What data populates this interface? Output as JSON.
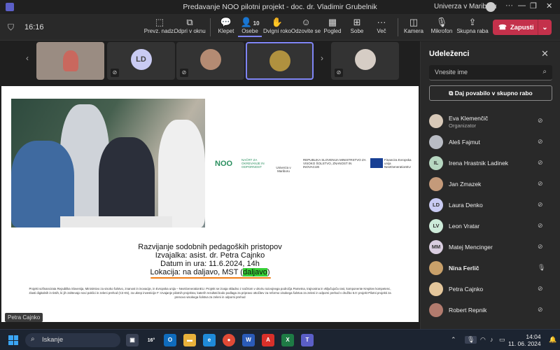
{
  "window": {
    "title": "Predavanje NOO pilotni projekt - doc. dr. Vladimir Grubelnik",
    "org": "Univerza v Mariboru"
  },
  "toolbar": {
    "time": "16:16",
    "items": [
      {
        "label": "Prevz. nadz.",
        "icon": "take-control-icon"
      },
      {
        "label": "Odpri v oknu",
        "icon": "pop-out-icon"
      },
      {
        "label": "Klepet",
        "icon": "chat-icon"
      },
      {
        "label": "Osebe",
        "icon": "people-icon",
        "badge": "10"
      },
      {
        "label": "Dvigni roko",
        "icon": "raise-hand-icon"
      },
      {
        "label": "Odzovite se",
        "icon": "react-icon"
      },
      {
        "label": "Pogled",
        "icon": "view-icon"
      },
      {
        "label": "Sobe",
        "icon": "rooms-icon"
      },
      {
        "label": "Več",
        "icon": "more-icon"
      },
      {
        "label": "Kamera",
        "icon": "camera-off-icon"
      },
      {
        "label": "Mikrofon",
        "icon": "mic-off-icon"
      },
      {
        "label": "Skupna raba",
        "icon": "share-icon"
      }
    ],
    "leave_label": "Zapusti"
  },
  "gallery": {
    "tiles": [
      {
        "initials": ""
      },
      {
        "initials": "LD"
      },
      {
        "initials": ""
      },
      {
        "initials": ""
      },
      {
        "initials": ""
      }
    ]
  },
  "slide": {
    "logos": [
      "NOO",
      "NAČRT ZA OKREVANJE IN ODPORNOST",
      "Univerza v Mariboru",
      "REPUBLIKA SLOVENIJA MINISTRSTVO ZA VISOKO ŠOLSTVO, ZNANOST IN INOVACIJE",
      "Financira Evropska unija NextGenerationEU"
    ],
    "title": "Razvijanje sodobnih pedagoških pristopov",
    "lecturer": "Izvajalka: asist. dr. Petra Cajnko",
    "datetime": "Datum in ura: 11.6.2024, 14h",
    "location_prefix": "Lokacija: na daljavo, MST (",
    "location_highlight": "daljavo",
    "location_suffix": ")",
    "footnote": "Projekt sofinancirata Republika Slovenija, Ministrstvo za visoko šolstvo, znanost in inovacije, in Evropska unija – NextGenerationEU. Projekt se izvaja skladno z načrtom v okviru razvojnega področja Pametna, trajnostna in vključujoča rast, komponente Krepitev kompetenc, zlasti digitalnih in tistih, ki jih zahtevajo novi poklici in zeleni prehod (C3 K5), za ukrep investicije F: Izvajanje pilotnih projektov, katerih rezultati bodo podlaga za pripravo ottočitev za reformo visokega šolstva za zeleni in odporni prehod v družbo 5.0: projekt Pilotni projekti za prenovo visokega šolstva za zeleni in odporni prehod",
    "speaker": "Petra Cajnko"
  },
  "panel": {
    "title": "Udeleženci",
    "search_placeholder": "Vnesite ime",
    "share_label": "Daj povabilo v skupno rabo",
    "people": [
      {
        "name": "Eva Klemenčič",
        "role": "Organizator",
        "initials": "",
        "color": "#d8c9b8",
        "mic": "off"
      },
      {
        "name": "Aleš Fajmut",
        "role": "",
        "initials": "",
        "color": "#b9bcc4",
        "mic": "off"
      },
      {
        "name": "Irena Hrastnik Ladinek",
        "role": "",
        "initials": "IL",
        "color": "#b7d7c1",
        "mic": "off"
      },
      {
        "name": "Jan Zmazek",
        "role": "",
        "initials": "",
        "color": "#c49a7a",
        "mic": "off"
      },
      {
        "name": "Laura Denko",
        "role": "",
        "initials": "LD",
        "color": "#c9cbf3",
        "mic": "off"
      },
      {
        "name": "Leon Vratar",
        "role": "",
        "initials": "LV",
        "color": "#cdebd9",
        "mic": "off"
      },
      {
        "name": "Matej Mencinger",
        "role": "",
        "initials": "MM",
        "color": "#d9cde0",
        "mic": "off"
      },
      {
        "name": "Nina Ferlič",
        "role": "",
        "initials": "",
        "color": "#c8a06a",
        "mic": "on",
        "bold": true
      },
      {
        "name": "Petra Cajnko",
        "role": "",
        "initials": "",
        "color": "#e4c69b",
        "mic": "off"
      },
      {
        "name": "Robert Repnik",
        "role": "",
        "initials": "",
        "color": "#b27b6e",
        "mic": "off"
      }
    ]
  },
  "taskbar": {
    "search": "Iskanje",
    "weather": "16°",
    "time": "14:04",
    "date": "11. 06. 2024"
  }
}
